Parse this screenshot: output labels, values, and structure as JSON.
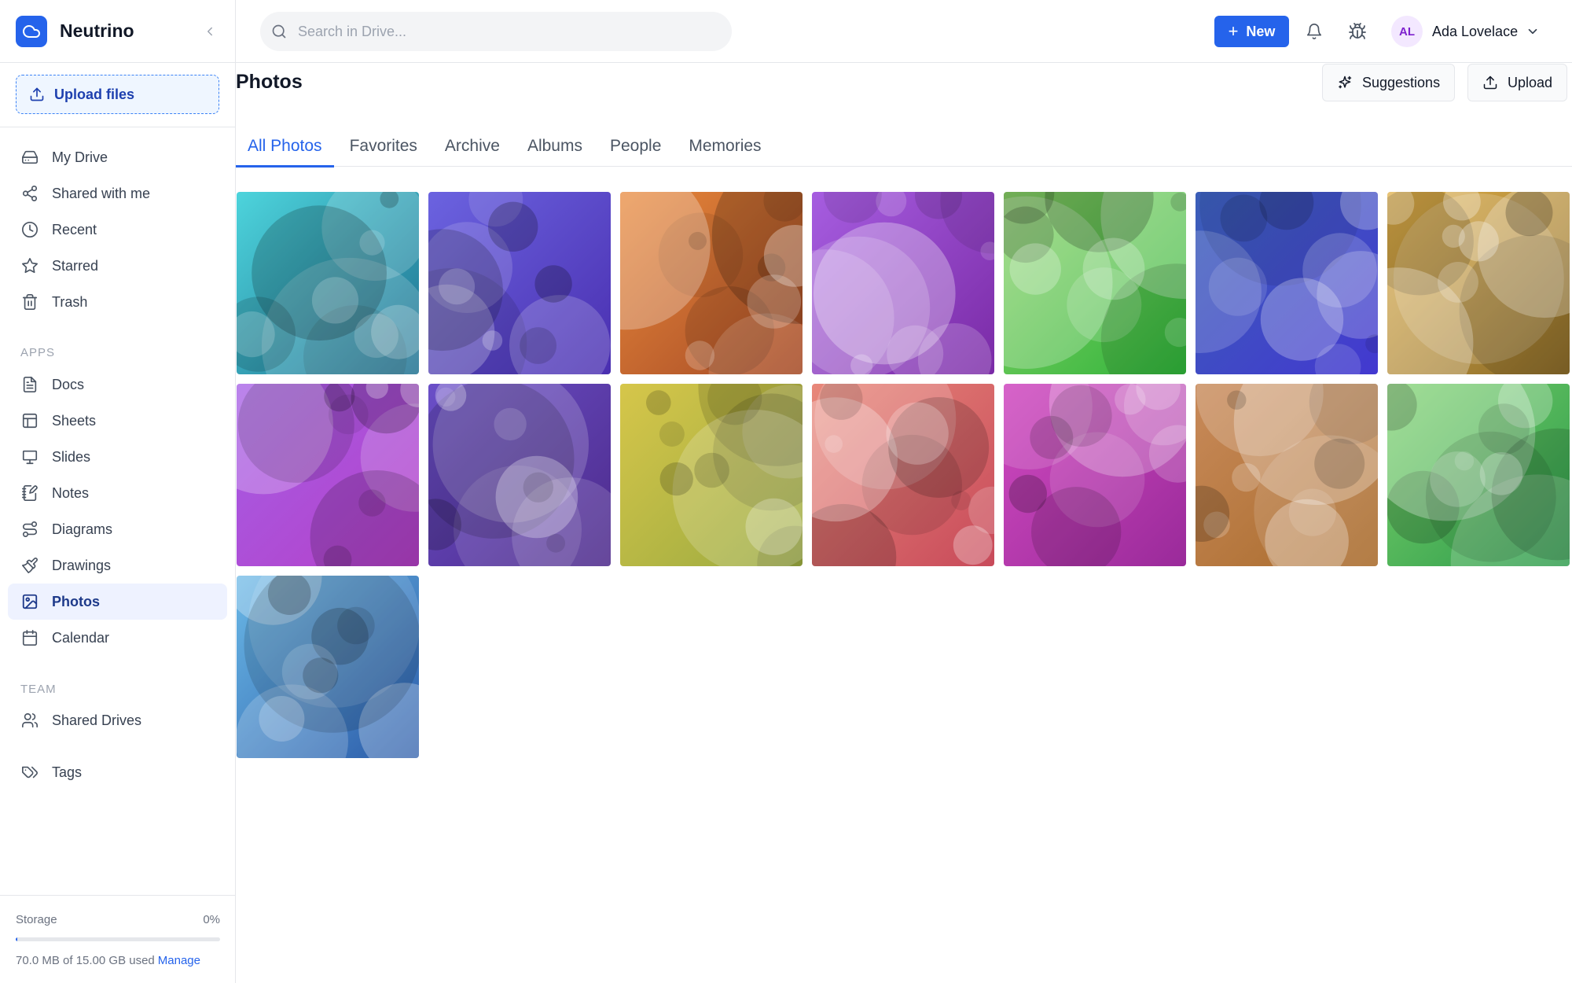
{
  "app": {
    "name": "Neutrino",
    "accent": "#2563eb"
  },
  "sidebar": {
    "upload_label": "Upload files",
    "main_items": [
      {
        "label": "My Drive",
        "icon": "drive-icon"
      },
      {
        "label": "Shared with me",
        "icon": "share-icon"
      },
      {
        "label": "Recent",
        "icon": "clock-icon"
      },
      {
        "label": "Starred",
        "icon": "star-icon"
      },
      {
        "label": "Trash",
        "icon": "trash-icon"
      }
    ],
    "apps_label": "APPS",
    "apps": [
      {
        "label": "Docs",
        "icon": "docs-icon"
      },
      {
        "label": "Sheets",
        "icon": "sheets-icon"
      },
      {
        "label": "Slides",
        "icon": "slides-icon"
      },
      {
        "label": "Notes",
        "icon": "notes-icon"
      },
      {
        "label": "Diagrams",
        "icon": "diagrams-icon"
      },
      {
        "label": "Drawings",
        "icon": "drawings-icon"
      },
      {
        "label": "Photos",
        "icon": "photos-icon",
        "active": true
      },
      {
        "label": "Calendar",
        "icon": "calendar-icon"
      }
    ],
    "team_label": "TEAM",
    "team": [
      {
        "label": "Shared Drives",
        "icon": "users-icon"
      }
    ],
    "tags_label": "Tags",
    "storage": {
      "label": "Storage",
      "percent_text": "0%",
      "used_fraction": 0.005,
      "used_text": "70.0 MB of 15.00 GB used",
      "manage_label": "Manage"
    }
  },
  "topbar": {
    "search_placeholder": "Search in Drive...",
    "new_label": "New",
    "user_initials": "AL",
    "user_name": "Ada Lovelace"
  },
  "main": {
    "title": "Photos",
    "suggestions_label": "Suggestions",
    "upload_label": "Upload",
    "tabs": [
      {
        "label": "All Photos",
        "active": true
      },
      {
        "label": "Favorites"
      },
      {
        "label": "Archive"
      },
      {
        "label": "Albums"
      },
      {
        "label": "People"
      },
      {
        "label": "Memories"
      }
    ],
    "photos": [
      {
        "c1": "#4dd4dc",
        "c2": "#1e6f8f"
      },
      {
        "c1": "#6b63e0",
        "c2": "#4a2fb0"
      },
      {
        "c1": "#e8883a",
        "c2": "#a54a26"
      },
      {
        "c1": "#a65de0",
        "c2": "#7a2aa6"
      },
      {
        "c1": "#8cd46a",
        "c2": "#2fb33a"
      },
      {
        "c1": "#3b5fb8",
        "c2": "#4338d0"
      },
      {
        "c1": "#e0b04a",
        "c2": "#8a6b2a"
      },
      {
        "c1": "#a55ee6",
        "c2": "#b540c8"
      },
      {
        "c1": "#6a4fc8",
        "c2": "#4d2a8a"
      },
      {
        "c1": "#d6c64a",
        "c2": "#9aaa40"
      },
      {
        "c1": "#e8887a",
        "c2": "#c84a5a"
      },
      {
        "c1": "#d04ac0",
        "c2": "#9a2a9a"
      },
      {
        "c1": "#c88a5a",
        "c2": "#a86a2a"
      },
      {
        "c1": "#7ad06a",
        "c2": "#2a9a4a"
      },
      {
        "c1": "#6ab8e6",
        "c2": "#2a5aa8"
      }
    ]
  }
}
